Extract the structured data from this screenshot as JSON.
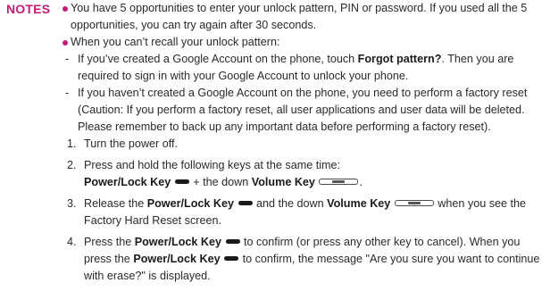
{
  "heading": "NOTES",
  "bullet1": "You have 5 opportunities to enter your unlock pattern, PIN or password. If you used all the 5 opportunities, you can try again after 30 seconds.",
  "bullet2": "When you can’t recall your unlock pattern:",
  "dash1": {
    "pre": "If you’ve created a Google Account on the phone, touch ",
    "link": "Forgot pattern?",
    "post": ". Then you are required to sign in with your Google Account to unlock your phone."
  },
  "dash2": "If you haven’t created a Google Account on the phone, you need to perform a factory reset (Caution: If you perform a factory reset, all user applications and user data will be deleted. Please remember to back up any important data before performing a factory reset).",
  "steps": {
    "s1_num": "1.",
    "s1": "Turn the power off.",
    "s2_num": "2.",
    "s2": "Press and hold the following keys at the same time:",
    "s2_line": {
      "power": "Power/Lock Key",
      "plus": " + the down ",
      "volume": "Volume Key",
      "end": "."
    },
    "s3_num": "3.",
    "s3": {
      "pre": "Release the ",
      "power": "Power/Lock Key",
      "mid": " and the down ",
      "volume": "Volume Key",
      "post": " when you see the Factory Hard Reset screen."
    },
    "s4_num": "4.",
    "s4": {
      "pre": "Press the ",
      "power": "Power/Lock Key",
      "mid": " to confirm (or press any other key to cancel). When you press the ",
      "power2": "Power/Lock Key",
      "post": " to confirm, the message \"Are you sure you want to continue with erase?\" is displayed."
    }
  },
  "icons": {
    "power_key": "power-lock-key-icon",
    "volume_key": "volume-key-icon"
  },
  "colors": {
    "accent": "#c8197a",
    "text": "#2a2a2a"
  }
}
